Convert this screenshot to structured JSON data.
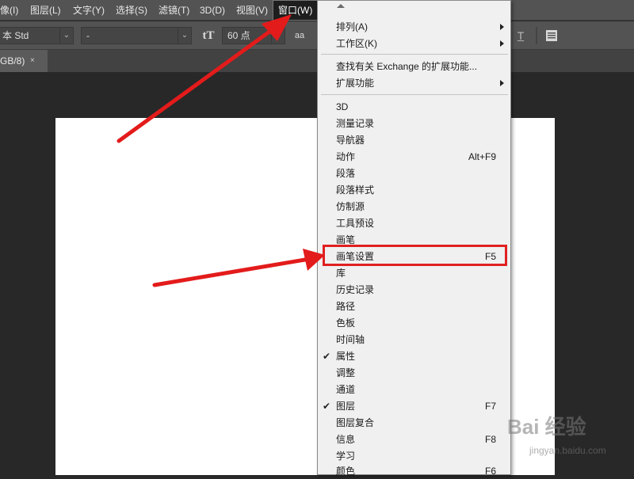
{
  "menubar": {
    "items": [
      {
        "label": "像(I)"
      },
      {
        "label": "图层(L)"
      },
      {
        "label": "文字(Y)"
      },
      {
        "label": "选择(S)"
      },
      {
        "label": "滤镜(T)"
      },
      {
        "label": "3D(D)"
      },
      {
        "label": "视图(V)"
      },
      {
        "label": "窗口(W)"
      }
    ]
  },
  "options_bar": {
    "font_family": "本 Std",
    "font_style": "-",
    "font_size_icon": "tT",
    "font_size": "60 点",
    "antialias_icon": "aa"
  },
  "tab": {
    "label": "GB/8)",
    "close": "×"
  },
  "window_menu": {
    "items": [
      {
        "label": "排列(A)",
        "shortcut": "",
        "submenu": true,
        "checked": false
      },
      {
        "label": "工作区(K)",
        "shortcut": "",
        "submenu": true,
        "checked": false
      },
      {
        "label": "查找有关 Exchange 的扩展功能...",
        "shortcut": "",
        "submenu": false,
        "checked": false
      },
      {
        "label": "扩展功能",
        "shortcut": "",
        "submenu": true,
        "checked": false
      },
      {
        "label": "3D",
        "shortcut": "",
        "submenu": false,
        "checked": false
      },
      {
        "label": "测量记录",
        "shortcut": "",
        "submenu": false,
        "checked": false
      },
      {
        "label": "导航器",
        "shortcut": "",
        "submenu": false,
        "checked": false
      },
      {
        "label": "动作",
        "shortcut": "Alt+F9",
        "submenu": false,
        "checked": false
      },
      {
        "label": "段落",
        "shortcut": "",
        "submenu": false,
        "checked": false
      },
      {
        "label": "段落样式",
        "shortcut": "",
        "submenu": false,
        "checked": false
      },
      {
        "label": "仿制源",
        "shortcut": "",
        "submenu": false,
        "checked": false
      },
      {
        "label": "工具预设",
        "shortcut": "",
        "submenu": false,
        "checked": false
      },
      {
        "label": "画笔",
        "shortcut": "",
        "submenu": false,
        "checked": false
      },
      {
        "label": "画笔设置",
        "shortcut": "F5",
        "submenu": false,
        "checked": false
      },
      {
        "label": "库",
        "shortcut": "",
        "submenu": false,
        "checked": false
      },
      {
        "label": "历史记录",
        "shortcut": "",
        "submenu": false,
        "checked": false
      },
      {
        "label": "路径",
        "shortcut": "",
        "submenu": false,
        "checked": false
      },
      {
        "label": "色板",
        "shortcut": "",
        "submenu": false,
        "checked": false
      },
      {
        "label": "时间轴",
        "shortcut": "",
        "submenu": false,
        "checked": false
      },
      {
        "label": "属性",
        "shortcut": "",
        "submenu": false,
        "checked": true
      },
      {
        "label": "调整",
        "shortcut": "",
        "submenu": false,
        "checked": false
      },
      {
        "label": "通道",
        "shortcut": "",
        "submenu": false,
        "checked": false
      },
      {
        "label": "图层",
        "shortcut": "F7",
        "submenu": false,
        "checked": true
      },
      {
        "label": "图层复合",
        "shortcut": "",
        "submenu": false,
        "checked": false
      },
      {
        "label": "信息",
        "shortcut": "F8",
        "submenu": false,
        "checked": false
      },
      {
        "label": "学习",
        "shortcut": "",
        "submenu": false,
        "checked": false
      },
      {
        "label": "颜色",
        "shortcut": "F6",
        "submenu": false,
        "checked": false
      }
    ]
  },
  "annotation": {
    "highlight_color": "#e02020",
    "arrow_color": "#e31b1b"
  },
  "watermark": {
    "brand": "Bai 经验",
    "sub": "jingyan.baidu.com"
  }
}
